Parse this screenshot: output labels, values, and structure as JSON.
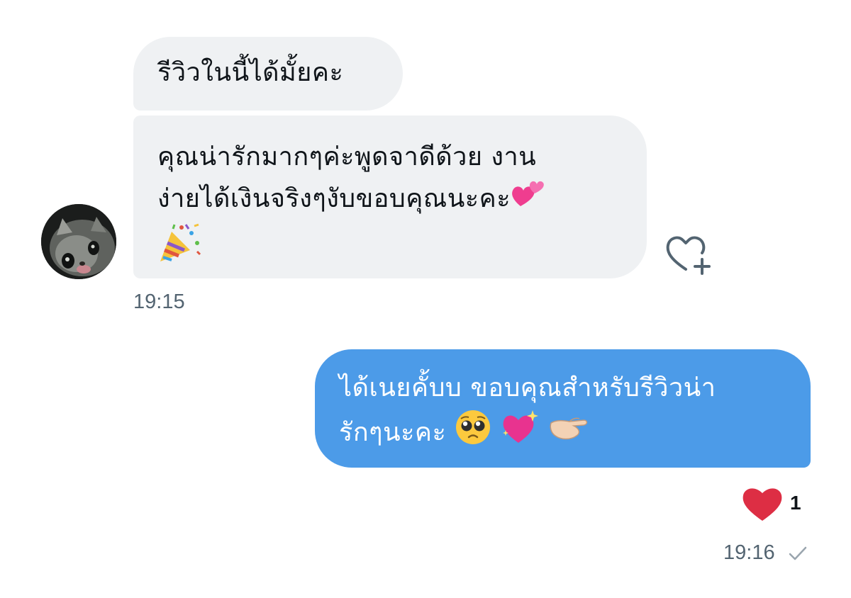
{
  "conversation": {
    "received": [
      {
        "text": "รีวิวในนี้ได้มั้ยคะ"
      },
      {
        "lines": [
          "คุณน่ารักมากๆค่ะพูดจาดีด้วย งาน",
          "ง่ายได้เงินจริงๆงับขอบคุณนะคะ"
        ],
        "emojis": [
          "two-hearts",
          "party-popper"
        ]
      }
    ],
    "received_time": "19:15",
    "sent": {
      "lines": [
        "ได้เนยคั้บบ ขอบคุณสำหรับรีวิวน่า",
        "รักๆนะคะ"
      ],
      "emojis": [
        "pleading-face",
        "sparkling-heart",
        "pinching-hand"
      ]
    },
    "sent_time": "19:16",
    "reaction": {
      "emoji": "red-heart",
      "count": "1"
    },
    "icons": [
      "add-reaction-icon",
      "sent-check-icon"
    ],
    "colors": {
      "incoming_bubble": "#eff1f3",
      "outgoing_bubble": "#4c9be8",
      "timestamp": "#536471",
      "heart": "#dd2e44"
    }
  }
}
